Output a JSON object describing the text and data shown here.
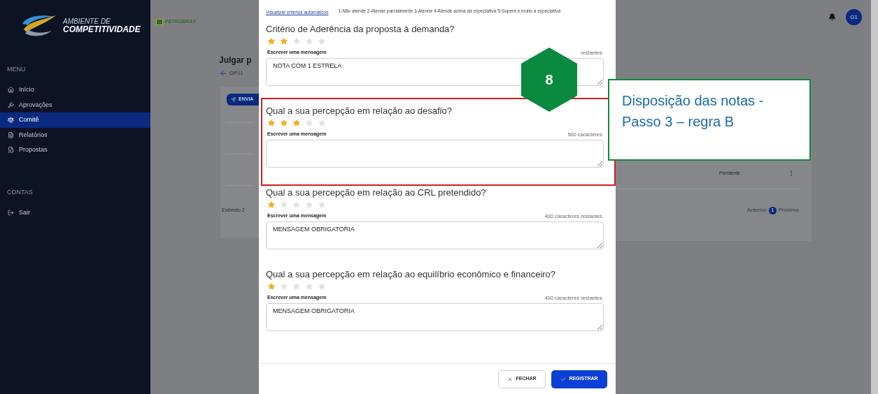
{
  "sidebar": {
    "brand": {
      "line1": "AMBIENTE DE",
      "line2": "COMPETITIVIDADE"
    },
    "sections": [
      {
        "title": "MENU",
        "items": [
          {
            "label": "Início",
            "selected": false
          },
          {
            "label": "Aprovações",
            "selected": false
          },
          {
            "label": "Comitê",
            "selected": true
          },
          {
            "label": "Relatórios",
            "selected": false
          },
          {
            "label": "Propostas",
            "selected": false
          }
        ]
      },
      {
        "title": "CONTAS",
        "items": [
          {
            "label": "Sair",
            "selected": false
          }
        ]
      }
    ]
  },
  "header": {
    "logo": "PETROBRAS",
    "avatar": "G1"
  },
  "page": {
    "title": "Julgar p",
    "code": "OP11",
    "send_button": "ENVIA",
    "showing": "Exibindo 2",
    "status": "Pendente",
    "pagination": {
      "previous": "Anterior",
      "current": "1",
      "next": "Próximo"
    }
  },
  "modal": {
    "link": "Visualizar critérios automáticos",
    "legend": "1-Não atende  2-Atende parcialmente  3-Atende  4-Atende acima da expectativa  5-Supera e muito a expectativa",
    "questions": [
      {
        "title": "Critério de Aderência da proposta à demanda?",
        "stars": 2,
        "label": "Escrever uma mensagem",
        "counter": "restantes",
        "value": "NOTA COM 1 ESTRELA"
      },
      {
        "title": "Qual a sua percepção em relação ao desafio?",
        "stars": 3,
        "label": "Escrever uma mensagem",
        "counter": "500 caracteres"
      },
      {
        "title": "Qual a sua percepção em relação ao CRL pretendido?",
        "stars": 1,
        "label": "Escrever uma mensagem",
        "counter": "400 caracteres restantes",
        "value": "MENSAGEM OBRIGATORIA"
      },
      {
        "title": "Qual a sua percepção em relação ao equilíbrio econômico e financeiro?",
        "stars": 1,
        "label": "Escrever uma mensagem",
        "counter": "400 caracteres restantes",
        "value": "MENSAGEM OBRIGATORIA"
      }
    ],
    "buttons": [
      {
        "kind": "secondary",
        "label": "FECHAR"
      },
      {
        "kind": "primary",
        "label": "REGISTRAR"
      }
    ]
  },
  "annotation": {
    "step": "8",
    "lines": [
      "Disposição das notas -",
      "Passo 3 – regra B"
    ]
  }
}
